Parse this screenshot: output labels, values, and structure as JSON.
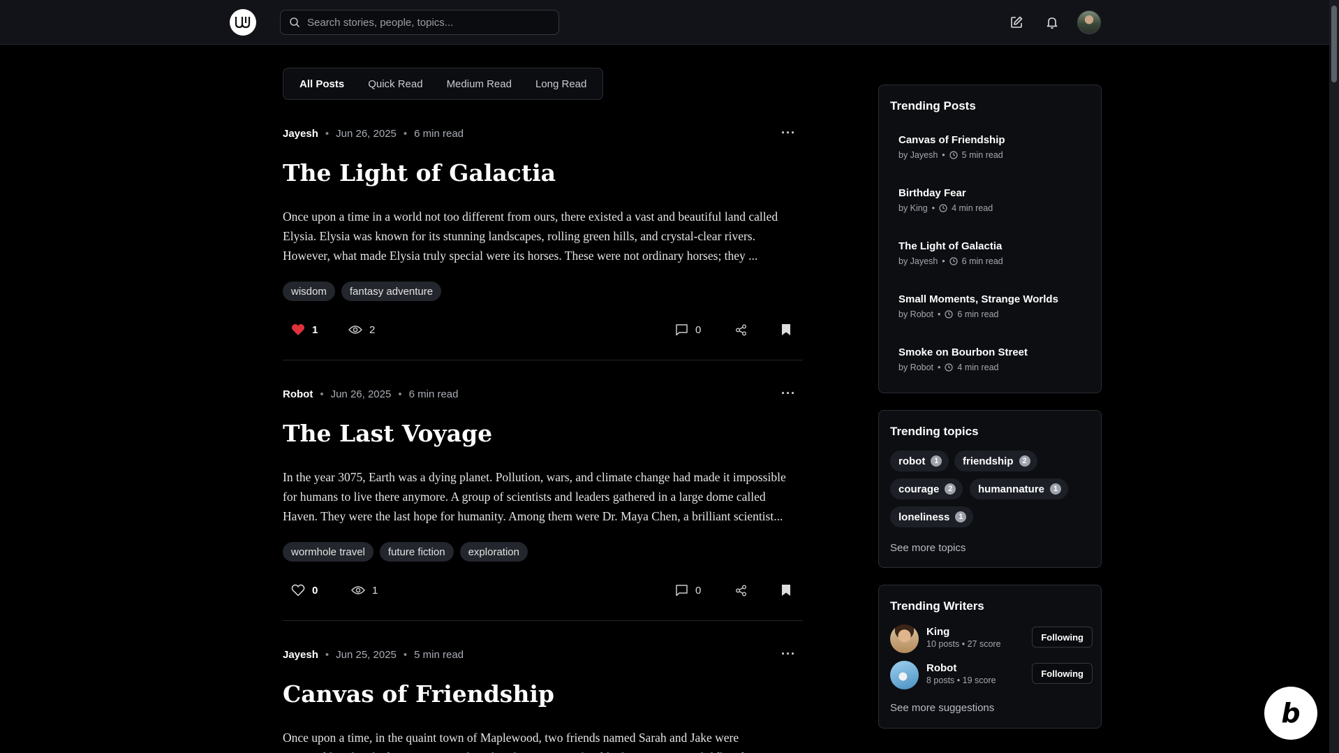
{
  "header": {
    "logo_text": "W",
    "search_placeholder": "Search stories, people, topics...",
    "icons": [
      "search-icon",
      "write-icon",
      "bell-icon",
      "avatar"
    ]
  },
  "tabs": [
    {
      "label": "All Posts",
      "active": true
    },
    {
      "label": "Quick Read",
      "active": false
    },
    {
      "label": "Medium Read",
      "active": false
    },
    {
      "label": "Long Read",
      "active": false
    }
  ],
  "posts": [
    {
      "author": "Jayesh",
      "date": "Jun 26, 2025",
      "read_time": "6 min read",
      "title": "The Light of Galactia",
      "excerpt": "Once upon a time in a world not too different from ours, there existed a vast and beautiful land called Elysia. Elysia was known for its stunning landscapes, rolling green hills, and crystal-clear rivers. However, what made Elysia truly special were its horses. These were not ordinary horses; they ...",
      "tags": [
        "wisdom",
        "fantasy adventure"
      ],
      "likes": "1",
      "liked": true,
      "views": "2",
      "comments": "0"
    },
    {
      "author": "Robot",
      "date": "Jun 26, 2025",
      "read_time": "6 min read",
      "title": "The Last Voyage",
      "excerpt": "In the year 3075, Earth was a dying planet. Pollution, wars, and climate change had made it impossible for humans to live there anymore. A group of scientists and leaders gathered in a large dome called Haven. They were the last hope for humanity. Among them were Dr. Maya Chen, a brilliant scientist...",
      "tags": [
        "wormhole travel",
        "future fiction",
        "exploration"
      ],
      "likes": "0",
      "liked": false,
      "views": "1",
      "comments": "0"
    },
    {
      "author": "Jayesh",
      "date": "Jun 25, 2025",
      "read_time": "5 min read",
      "title": "Canvas of Friendship",
      "excerpt": "Once upon a time, in the quaint town of Maplewood, two friends named Sarah and Jake were inseparable. They had grown up together, their houses just a few blocks apart. From childhood"
    }
  ],
  "trending_posts": {
    "heading": "Trending Posts",
    "items": [
      {
        "title": "Canvas of Friendship",
        "by": "by Jayesh",
        "read": "5 min read"
      },
      {
        "title": "Birthday Fear",
        "by": "by King",
        "read": "4 min read"
      },
      {
        "title": "The Light of Galactia",
        "by": "by Jayesh",
        "read": "6 min read"
      },
      {
        "title": "Small Moments, Strange Worlds",
        "by": "by Robot",
        "read": "6 min read"
      },
      {
        "title": "Smoke on Bourbon Street",
        "by": "by Robot",
        "read": "4 min read"
      }
    ]
  },
  "trending_topics": {
    "heading": "Trending topics",
    "items": [
      {
        "name": "robot",
        "count": "1"
      },
      {
        "name": "friendship",
        "count": "2"
      },
      {
        "name": "courage",
        "count": "2"
      },
      {
        "name": "humannature",
        "count": "1"
      },
      {
        "name": "loneliness",
        "count": "1"
      }
    ],
    "see_more": "See more topics"
  },
  "trending_writers": {
    "heading": "Trending Writers",
    "items": [
      {
        "name": "King",
        "posts": "10 posts",
        "score": "27 score",
        "button": "Following"
      },
      {
        "name": "Robot",
        "posts": "8 posts",
        "score": "19 score",
        "button": "Following"
      }
    ],
    "see_more": "See more suggestions"
  },
  "badge": {
    "letter": "b"
  },
  "colors": {
    "background": "#000000",
    "card": "#0d0e12",
    "heart": "#e0323c",
    "tag": "#23262d"
  }
}
